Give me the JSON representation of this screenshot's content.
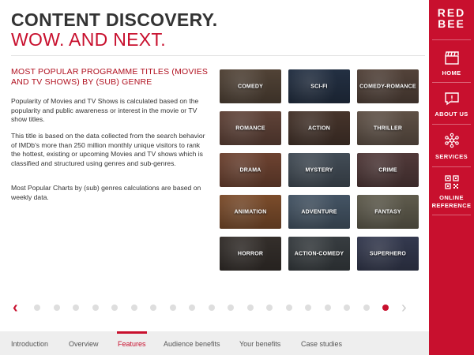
{
  "header": {
    "title_line1": "CONTENT DISCOVERY.",
    "title_line2": "WOW. AND NEXT."
  },
  "content": {
    "heading": "MOST POPULAR PROGRAMME TITLES (MOVIES AND TV SHOWS) BY (SUB) GENRE",
    "paragraphs": [
      "Popularity of Movies and TV Shows is calculated based on the popularity and public awareness or interest in the movie or TV show titles.",
      "This title is based on the data collected from the search behavior of IMDb's more than 250 million monthly unique visitors to rank the hottest, existing or upcoming Movies and TV shows which is classified and structured using genres and sub-genres.",
      "Most Popular Charts by (sub) genres calculations are based on weekly data."
    ]
  },
  "genres": [
    {
      "label": "COMEDY",
      "color": "#5a4a3c"
    },
    {
      "label": "SCI-FI",
      "color": "#27354a"
    },
    {
      "label": "COMEDY-ROMANCE",
      "color": "#5c4a40"
    },
    {
      "label": "ROMANCE",
      "color": "#6b4a3e"
    },
    {
      "label": "ACTION",
      "color": "#4e3a30"
    },
    {
      "label": "THRILLER",
      "color": "#6a5a4e"
    },
    {
      "label": "DRAMA",
      "color": "#7a4a36"
    },
    {
      "label": "MYSTERY",
      "color": "#4a5560"
    },
    {
      "label": "CRIME",
      "color": "#5a4040"
    },
    {
      "label": "ANIMATION",
      "color": "#8a5530"
    },
    {
      "label": "ADVENTURE",
      "color": "#4c5e70"
    },
    {
      "label": "FANTASY",
      "color": "#6a6656"
    },
    {
      "label": "HORROR",
      "color": "#3a3430"
    },
    {
      "label": "ACTION-COMEDY",
      "color": "#3e4448"
    },
    {
      "label": "SUPERHERO",
      "color": "#3a4058"
    }
  ],
  "pagination": {
    "total_pages": 19,
    "current_page": 19
  },
  "bottom_tabs": [
    "Introduction",
    "Overview",
    "Features",
    "Audience benefits",
    "Your benefits",
    "Case studies"
  ],
  "sidebar": {
    "logo_line1": "RED",
    "logo_line2": "BEE",
    "items": [
      {
        "label": "HOME",
        "icon": "clapperboard-icon"
      },
      {
        "label": "ABOUT US",
        "icon": "chat-icon"
      },
      {
        "label": "SERVICES",
        "icon": "network-icon"
      },
      {
        "label": "ONLINE REFERENCE",
        "icon": "qr-code-icon"
      }
    ]
  },
  "colors": {
    "brand_red": "#c8102e",
    "dot_inactive": "#dedede",
    "bottom_bar": "#eeeeee"
  }
}
